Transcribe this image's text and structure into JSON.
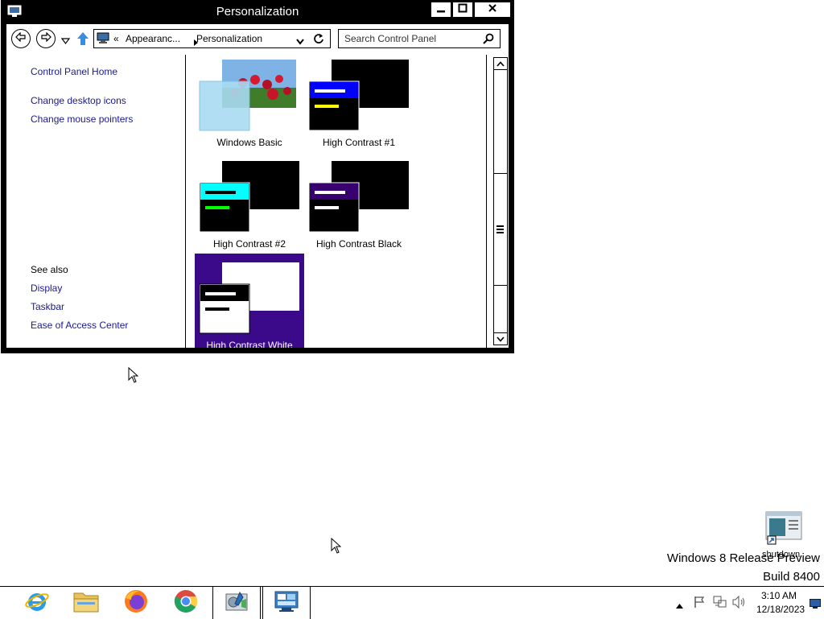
{
  "window": {
    "title": "Personalization",
    "minimize_icon": "minimize-icon",
    "maximize_icon": "maximize-icon",
    "close_icon": "close-icon"
  },
  "navbar": {
    "address_segments": [
      "Appearanc...",
      "Personalization"
    ],
    "address_prefix": "«",
    "search_placeholder": "Search Control Panel"
  },
  "sidebar": {
    "links": [
      "Control Panel Home",
      "Change desktop icons",
      "Change mouse pointers"
    ],
    "see_also_heading": "See also",
    "see_also": [
      "Display",
      "Taskbar",
      "Ease of Access Center"
    ]
  },
  "themes": [
    {
      "label": "Windows Basic",
      "selected": false
    },
    {
      "label": "High Contrast #1",
      "selected": false
    },
    {
      "label": "High Contrast #2",
      "selected": false
    },
    {
      "label": "High Contrast Black",
      "selected": false
    },
    {
      "label": "High Contrast White",
      "selected": true
    }
  ],
  "desktop": {
    "shortcut_label": "shutdown",
    "watermark_line1": "Windows 8 Release Preview",
    "watermark_line2": "Build 8400"
  },
  "taskbar": {
    "apps": [
      "internet-explorer-icon",
      "file-explorer-icon",
      "firefox-icon",
      "chrome-icon",
      "control-panel-icon",
      "personalization-icon"
    ],
    "time": "3:10 AM",
    "date": "12/18/2023"
  },
  "colors": {
    "selection_purple": "#3b0a8a",
    "link_blue": "#1a1a8c"
  }
}
